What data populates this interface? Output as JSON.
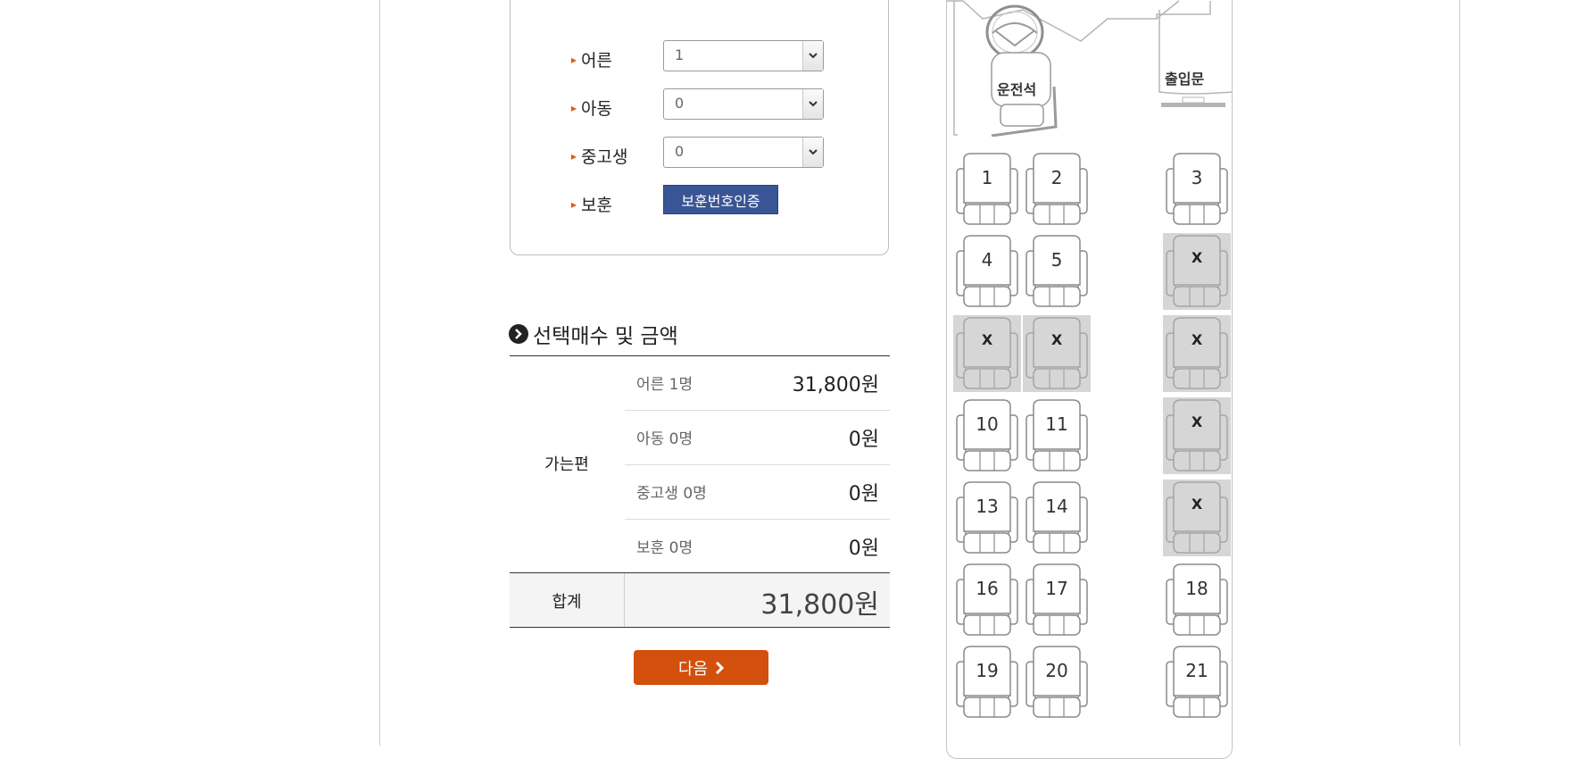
{
  "passengers": {
    "adult": {
      "label": "어른",
      "value": "1"
    },
    "child": {
      "label": "아동",
      "value": "0"
    },
    "student": {
      "label": "중고생",
      "value": "0"
    },
    "veteran": {
      "label": "보훈",
      "button_label": "보훈번호인증"
    }
  },
  "summary": {
    "title": "선택매수 및 금액",
    "trip_label": "가는편",
    "rows": [
      {
        "label": "어른 1명",
        "amount": "31,800원"
      },
      {
        "label": "아동 0명",
        "amount": "0원"
      },
      {
        "label": "중고생 0명",
        "amount": "0원"
      },
      {
        "label": "보훈 0명",
        "amount": "0원"
      }
    ],
    "total_label": "합계",
    "total_amount": "31,800원"
  },
  "next_button": {
    "label": "다음"
  },
  "bus": {
    "driver_label": "운전석",
    "door_label": "출입문",
    "seats": [
      {
        "label": "1",
        "taken": false
      },
      {
        "label": "2",
        "taken": false
      },
      {
        "label": "3",
        "taken": false
      },
      {
        "label": "4",
        "taken": false
      },
      {
        "label": "5",
        "taken": false
      },
      {
        "label": "X",
        "taken": true
      },
      {
        "label": "X",
        "taken": true
      },
      {
        "label": "X",
        "taken": true
      },
      {
        "label": "X",
        "taken": true
      },
      {
        "label": "10",
        "taken": false
      },
      {
        "label": "11",
        "taken": false
      },
      {
        "label": "X",
        "taken": true
      },
      {
        "label": "13",
        "taken": false
      },
      {
        "label": "14",
        "taken": false
      },
      {
        "label": "X",
        "taken": true
      },
      {
        "label": "16",
        "taken": false
      },
      {
        "label": "17",
        "taken": false
      },
      {
        "label": "18",
        "taken": false
      },
      {
        "label": "19",
        "taken": false
      },
      {
        "label": "20",
        "taken": false
      },
      {
        "label": "21",
        "taken": false
      }
    ]
  },
  "colors": {
    "accent_orange": "#d24f0c",
    "verify_blue": "#3a5596",
    "taken_seat_gray": "#d6d6d6"
  }
}
